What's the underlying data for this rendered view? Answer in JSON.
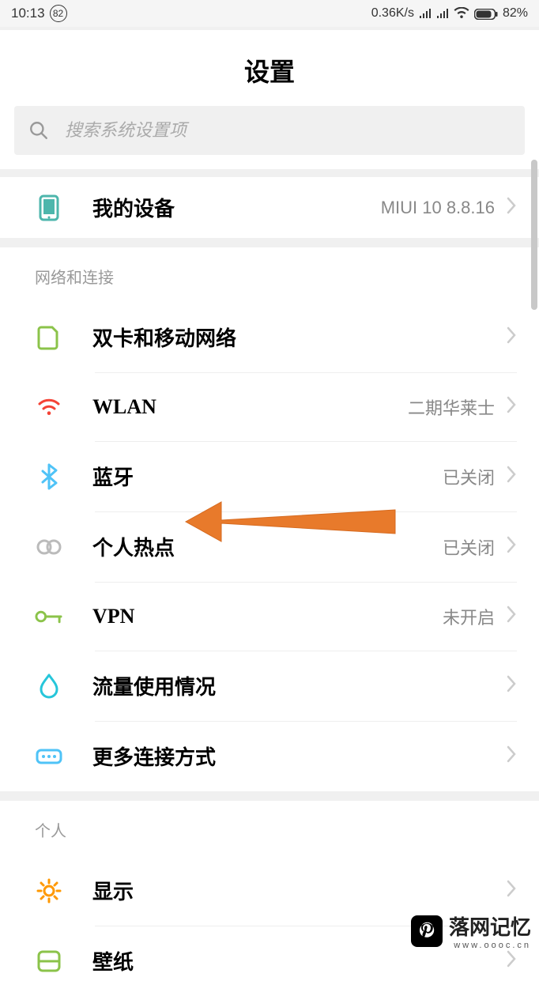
{
  "status": {
    "time": "10:13",
    "badge": "82",
    "speed": "0.36K/s",
    "battery_pct": "82%"
  },
  "page_title": "设置",
  "search": {
    "placeholder": "搜索系统设置项"
  },
  "my_device": {
    "label": "我的设备",
    "value": "MIUI 10 8.8.16"
  },
  "sections": {
    "network": {
      "header": "网络和连接",
      "items": {
        "sim": {
          "label": "双卡和移动网络",
          "value": ""
        },
        "wlan": {
          "label": "WLAN",
          "value": "二期华莱士"
        },
        "bluetooth": {
          "label": "蓝牙",
          "value": "已关闭"
        },
        "hotspot": {
          "label": "个人热点",
          "value": "已关闭"
        },
        "vpn": {
          "label": "VPN",
          "value": "未开启"
        },
        "data_usage": {
          "label": "流量使用情况",
          "value": ""
        },
        "more": {
          "label": "更多连接方式",
          "value": ""
        }
      }
    },
    "personal": {
      "header": "个人",
      "items": {
        "display": {
          "label": "显示",
          "value": ""
        },
        "wallpaper": {
          "label": "壁纸",
          "value": ""
        }
      }
    }
  },
  "watermark": {
    "text": "落网记忆",
    "url": "www.oooc.cn"
  },
  "colors": {
    "icon_green": "#8bc34a",
    "icon_teal": "#4db6ac",
    "icon_orange": "#ff9800",
    "icon_blue": "#4fc3f7",
    "icon_red": "#f44336",
    "icon_cyan": "#26c6da",
    "arrow": "#e87a2b"
  }
}
